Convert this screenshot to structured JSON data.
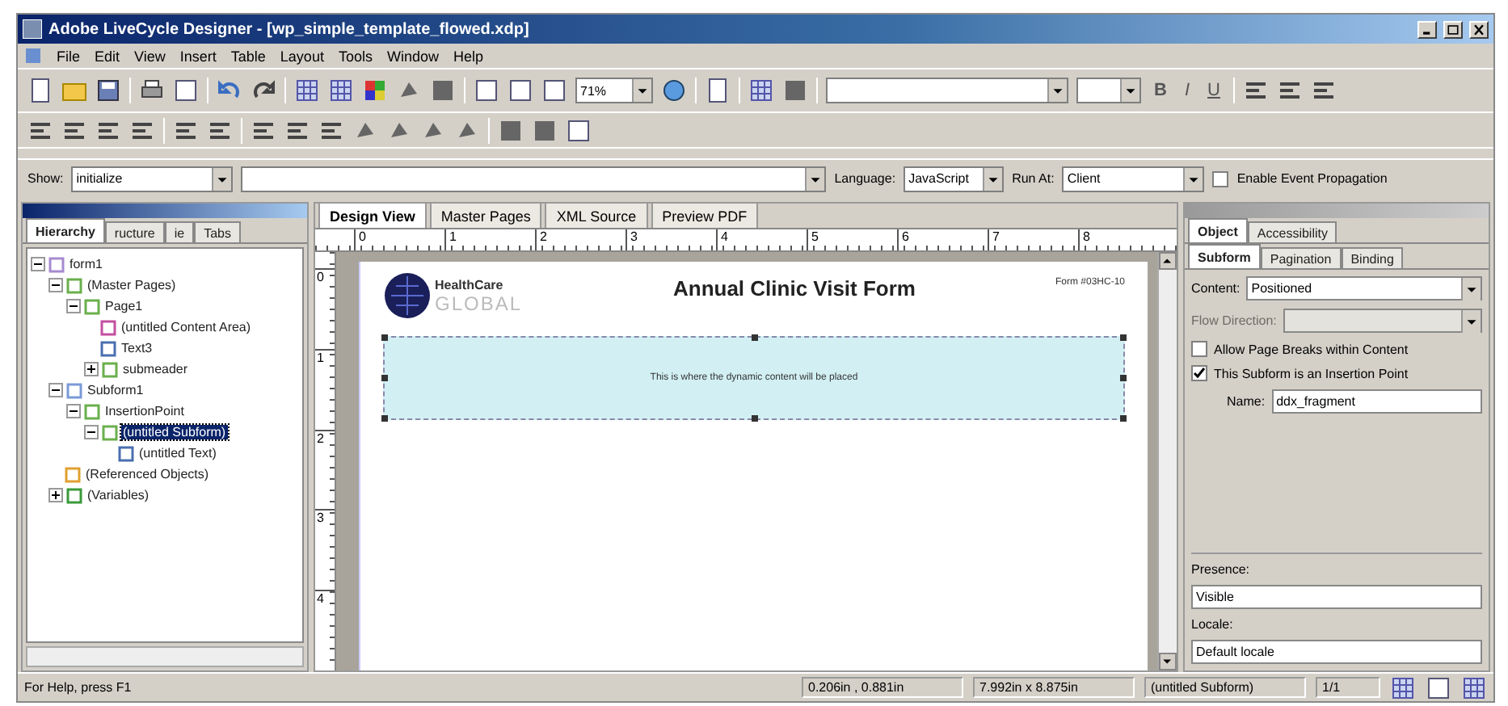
{
  "window": {
    "title": "Adobe LiveCycle Designer - [wp_simple_template_flowed.xdp]"
  },
  "menu": [
    "File",
    "Edit",
    "View",
    "Insert",
    "Table",
    "Layout",
    "Tools",
    "Window",
    "Help"
  ],
  "toolbar": {
    "zoom": "71%",
    "format_buttons": [
      "B",
      "I",
      "U"
    ]
  },
  "script_bar": {
    "show_label": "Show:",
    "show_value": "initialize",
    "language_label": "Language:",
    "language": "JavaScript",
    "run_at_label": "Run At:",
    "run_at": "Client",
    "propagation": {
      "label": "Enable Event Propagation",
      "checked": false
    }
  },
  "hierarchy": {
    "tabs": [
      {
        "label": "Hierarchy",
        "selected": true
      },
      {
        "label": "ructure",
        "selected": false
      },
      {
        "label": "ie",
        "selected": false
      },
      {
        "label": "Tabs",
        "selected": false
      }
    ],
    "tree": [
      {
        "label": "form1",
        "kind": "form",
        "expanded": true,
        "selected": false,
        "children": [
          {
            "label": "(Master Pages)",
            "kind": "master",
            "expanded": true,
            "selected": false,
            "children": [
              {
                "label": "Page1",
                "kind": "page",
                "expanded": true,
                "selected": false,
                "children": [
                  {
                    "label": "(untitled Content Area)",
                    "kind": "area",
                    "selected": false
                  },
                  {
                    "label": "Text3",
                    "kind": "text",
                    "selected": false
                  },
                  {
                    "label": "submeader",
                    "kind": "page",
                    "expanded": false,
                    "selected": false
                  }
                ]
              }
            ]
          },
          {
            "label": "Subform1",
            "kind": "subform",
            "expanded": true,
            "selected": false,
            "children": [
              {
                "label": "InsertionPoint",
                "kind": "page",
                "expanded": true,
                "selected": false,
                "children": [
                  {
                    "label": "(untitled Subform)",
                    "kind": "page",
                    "expanded": true,
                    "selected": true,
                    "children": [
                      {
                        "label": "(untitled Text)",
                        "kind": "text",
                        "selected": false
                      }
                    ]
                  }
                ]
              }
            ]
          },
          {
            "label": "(Referenced Objects)",
            "kind": "ref",
            "selected": false
          },
          {
            "label": "(Variables)",
            "kind": "vars",
            "expanded": false,
            "selected": false
          }
        ]
      }
    ]
  },
  "document_tabs": [
    {
      "label": "Design View",
      "selected": true
    },
    {
      "label": "Master Pages",
      "selected": false
    },
    {
      "label": "XML Source",
      "selected": false
    },
    {
      "label": "Preview PDF",
      "selected": false
    }
  ],
  "ruler": {
    "horizontal": [
      "0",
      "1",
      "2",
      "3",
      "4",
      "5",
      "6",
      "7",
      "8"
    ],
    "vertical": [
      "0",
      "1",
      "2",
      "3",
      "4"
    ]
  },
  "page": {
    "logo_top": "HealthCare",
    "logo_bottom": "GLOBAL",
    "title": "Annual Clinic Visit Form",
    "form_number": "Form #03HC-10",
    "subform_text": "This is where the dynamic content will be placed"
  },
  "object_panel": {
    "tabs": [
      {
        "label": "Object",
        "selected": true
      },
      {
        "label": "Accessibility",
        "selected": false
      }
    ],
    "subtabs": [
      {
        "label": "Subform",
        "selected": true
      },
      {
        "label": "Pagination",
        "selected": false
      },
      {
        "label": "Binding",
        "selected": false
      }
    ],
    "content_label": "Content:",
    "content": "Positioned",
    "flow_label": "Flow Direction:",
    "checks": [
      {
        "label": "Allow Page Breaks within Content",
        "checked": false
      },
      {
        "label": "This Subform is an Insertion Point",
        "checked": true
      }
    ],
    "name_label": "Name:",
    "name": "ddx_fragment",
    "presence_label": "Presence:",
    "presence": "Visible",
    "locale_label": "Locale:",
    "locale": "Default locale"
  },
  "status_bar": {
    "help": "For Help, press F1",
    "position": "0.206in , 0.881in",
    "size": "7.992in x 8.875in",
    "object": "(untitled Subform)",
    "page": "1/1"
  }
}
